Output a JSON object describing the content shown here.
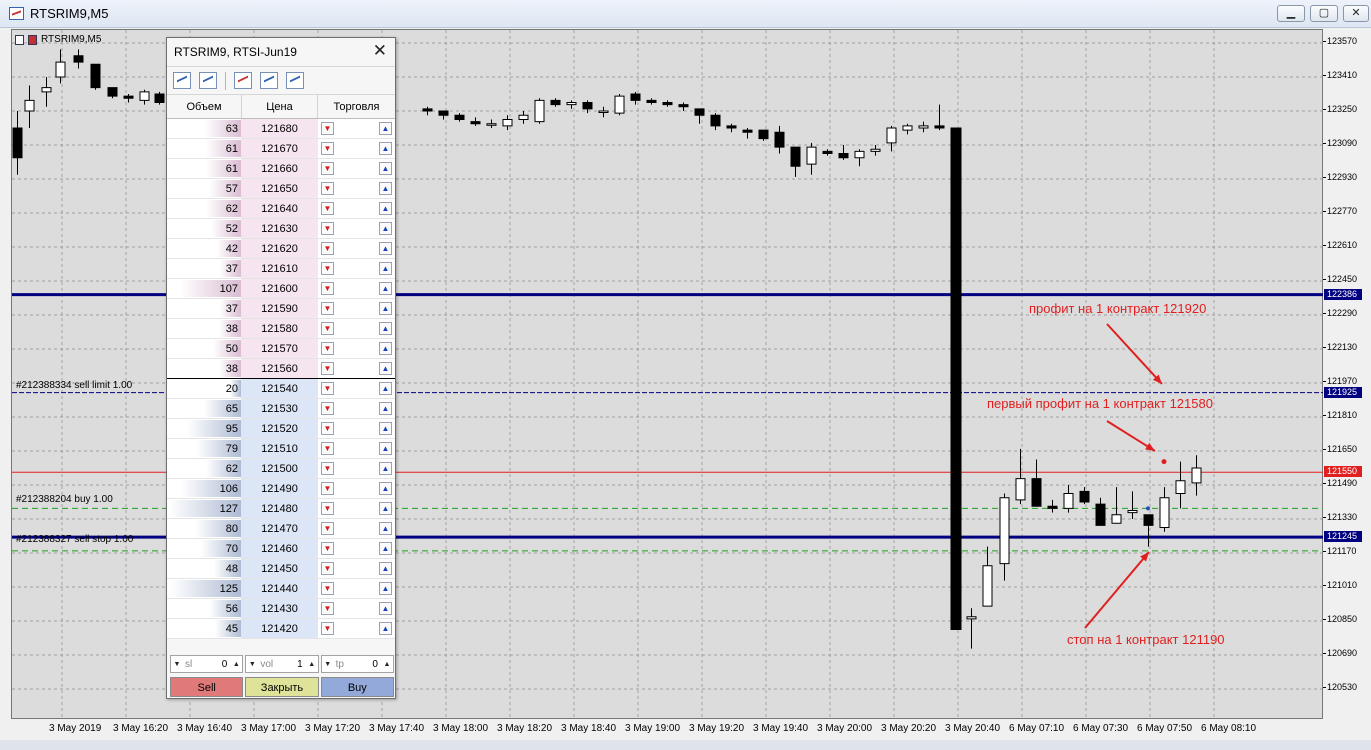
{
  "window": {
    "title": "RTSRIM9,M5"
  },
  "chart": {
    "caption": "RTSRIM9,M5",
    "price_axis": [
      "123570",
      "123410",
      "123250",
      "123090",
      "122930",
      "122770",
      "122610",
      "122450",
      "122290",
      "122130",
      "121970",
      "121810",
      "121650",
      "121490",
      "121330",
      "121170",
      "121010",
      "120850",
      "120690",
      "120530"
    ],
    "time_axis": [
      "3 May 2019",
      "3 May 16:20",
      "3 May 16:40",
      "3 May 17:00",
      "3 May 17:20",
      "3 May 17:40",
      "3 May 18:00",
      "3 May 18:20",
      "3 May 18:40",
      "3 May 19:00",
      "3 May 19:20",
      "3 May 19:40",
      "3 May 20:00",
      "3 May 20:20",
      "3 May 20:40",
      "6 May 07:10",
      "6 May 07:30",
      "6 May 07:50",
      "6 May 08:10"
    ],
    "badges": [
      {
        "price": "122386",
        "color": "#000080"
      },
      {
        "price": "121925",
        "color": "#000080"
      },
      {
        "price": "121550",
        "color": "#e02020"
      },
      {
        "price": "121245",
        "color": "#000080"
      }
    ],
    "order_labels": [
      {
        "text": "#212388334 sell limit 1.00"
      },
      {
        "text": "#212388204 buy 1.00"
      },
      {
        "text": "#212388327 sell stop 1.00"
      }
    ],
    "annotations": [
      {
        "text": "профит на 1 контракт 121920"
      },
      {
        "text": "первый профит на 1 контракт 121580"
      },
      {
        "text": "стоп на 1 контракт 121190"
      }
    ],
    "colors": {
      "background": "#dcdcdc",
      "grid": "#8a8a8a",
      "bull": "#ffffff",
      "bear": "#000000",
      "level": "#000080",
      "bid_line": "#e02020",
      "order": "#20a020",
      "annotation": "#e02020"
    }
  },
  "dom": {
    "title": "RTSRIM9, RTSI-Jun19",
    "close_glyph": "✕",
    "headers": {
      "volume": "Объем",
      "price": "Цена",
      "trade": "Торговля"
    },
    "asks": [
      {
        "volume": "63",
        "price": "121680"
      },
      {
        "volume": "61",
        "price": "121670"
      },
      {
        "volume": "61",
        "price": "121660"
      },
      {
        "volume": "57",
        "price": "121650"
      },
      {
        "volume": "62",
        "price": "121640"
      },
      {
        "volume": "52",
        "price": "121630"
      },
      {
        "volume": "42",
        "price": "121620"
      },
      {
        "volume": "37",
        "price": "121610"
      },
      {
        "volume": "107",
        "price": "121600"
      },
      {
        "volume": "37",
        "price": "121590"
      },
      {
        "volume": "38",
        "price": "121580"
      },
      {
        "volume": "50",
        "price": "121570"
      },
      {
        "volume": "38",
        "price": "121560"
      }
    ],
    "bids": [
      {
        "volume": "20",
        "price": "121540"
      },
      {
        "volume": "65",
        "price": "121530"
      },
      {
        "volume": "95",
        "price": "121520"
      },
      {
        "volume": "79",
        "price": "121510"
      },
      {
        "volume": "62",
        "price": "121500"
      },
      {
        "volume": "106",
        "price": "121490"
      },
      {
        "volume": "127",
        "price": "121480"
      },
      {
        "volume": "80",
        "price": "121470"
      },
      {
        "volume": "70",
        "price": "121460"
      },
      {
        "volume": "48",
        "price": "121450"
      },
      {
        "volume": "125",
        "price": "121440"
      },
      {
        "volume": "56",
        "price": "121430"
      },
      {
        "volume": "45",
        "price": "121420"
      }
    ],
    "controls": {
      "sl_label": "sl",
      "sl_value": "0",
      "vol_label": "vol",
      "vol_value": "1",
      "tp_label": "tp",
      "tp_value": "0"
    },
    "actions": {
      "sell": "Sell",
      "close": "Закрыть",
      "buy": "Buy"
    }
  }
}
